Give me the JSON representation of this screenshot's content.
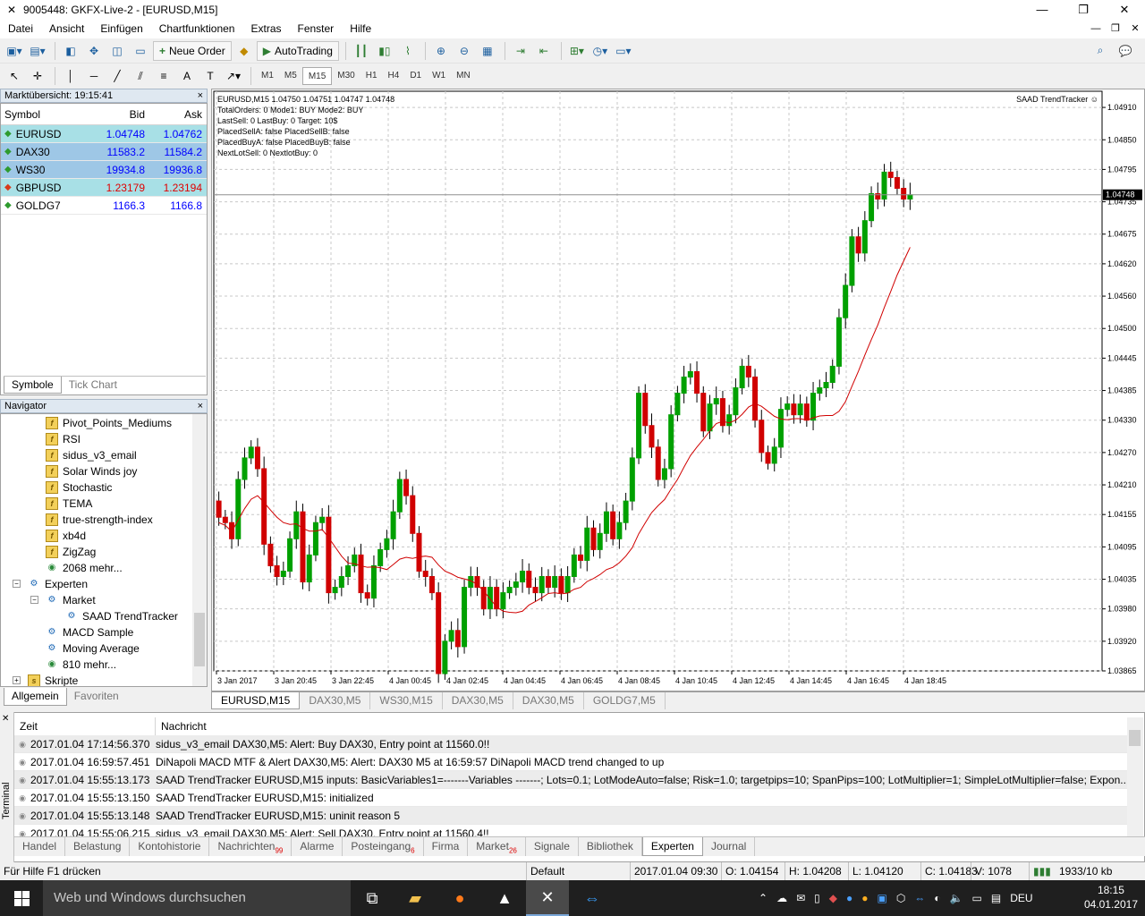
{
  "window": {
    "title": "9005448: GKFX-Live-2 - [EURUSD,M15]",
    "minimize": "—",
    "maximize": "❐",
    "close": "✕"
  },
  "menu": {
    "items": [
      "Datei",
      "Ansicht",
      "Einfügen",
      "Chartfunktionen",
      "Extras",
      "Fenster",
      "Hilfe"
    ],
    "mdi": [
      "—",
      "❐",
      "✕"
    ]
  },
  "toolbar": {
    "new_order": "Neue Order",
    "autotrading": "AutoTrading",
    "timeframes": [
      "M1",
      "M5",
      "M15",
      "M30",
      "H1",
      "H4",
      "D1",
      "W1",
      "MN"
    ],
    "active_timeframe": "M15"
  },
  "market_watch": {
    "header": "Marktübersicht: 19:15:41",
    "columns": [
      "Symbol",
      "Bid",
      "Ask"
    ],
    "rows": [
      {
        "symbol": "EURUSD",
        "bid": "1.04748",
        "ask": "1.04762",
        "dir": "up",
        "bg": "teal",
        "color": "#0000ff"
      },
      {
        "symbol": "DAX30",
        "bid": "11583.2",
        "ask": "11584.2",
        "dir": "up",
        "bg": "blue",
        "color": "#0000ff"
      },
      {
        "symbol": "WS30",
        "bid": "19934.8",
        "ask": "19936.8",
        "dir": "up",
        "bg": "blue",
        "color": "#0000ff"
      },
      {
        "symbol": "GBPUSD",
        "bid": "1.23179",
        "ask": "1.23194",
        "dir": "down",
        "bg": "teal",
        "color": "#e00000"
      },
      {
        "symbol": "GOLDG7",
        "bid": "1166.3",
        "ask": "1166.8",
        "dir": "up",
        "bg": "none",
        "color": "#0000ff"
      }
    ],
    "tabs": [
      "Symbole",
      "Tick Chart"
    ]
  },
  "navigator": {
    "header": "Navigator",
    "items": [
      {
        "label": "Pivot_Points_Mediums",
        "type": "indicator"
      },
      {
        "label": "RSI",
        "type": "indicator"
      },
      {
        "label": "sidus_v3_email",
        "type": "indicator"
      },
      {
        "label": "Solar Winds joy",
        "type": "indicator"
      },
      {
        "label": "Stochastic",
        "type": "indicator"
      },
      {
        "label": "TEMA",
        "type": "indicator"
      },
      {
        "label": "true-strength-index",
        "type": "indicator"
      },
      {
        "label": "xb4d",
        "type": "indicator"
      },
      {
        "label": "ZigZag",
        "type": "indicator"
      },
      {
        "label": "2068 mehr...",
        "type": "globe"
      },
      {
        "label": "Experten",
        "type": "expert-folder"
      },
      {
        "label": "Market",
        "type": "expert-folder"
      },
      {
        "label": "SAAD TrendTracker",
        "type": "expert"
      },
      {
        "label": "MACD Sample",
        "type": "expert"
      },
      {
        "label": "Moving Average",
        "type": "expert"
      },
      {
        "label": "810 mehr...",
        "type": "globe"
      },
      {
        "label": "Skripte",
        "type": "script-folder"
      }
    ],
    "tabs": [
      "Allgemein",
      "Favoriten"
    ]
  },
  "chart": {
    "header": "EURUSD,M15  1.04750 1.04751 1.04747 1.04748",
    "info_lines": [
      "TotalOrders:  0   Mode1:  BUY  Mode2:  BUY",
      "LastSell: 0  LastBuy: 0   Target: 10$",
      "PlacedSellA: false PlacedSellB: false",
      "PlacedBuyA: false PlacedBuyB: false",
      "NextLotSell:  0   NextlotBuy:  0"
    ],
    "ea_label": "SAAD TrendTracker ☺",
    "current_price_label": "1.04748",
    "tabs": [
      "EURUSD,M15",
      "DAX30,M5",
      "WS30,M15",
      "DAX30,M5",
      "DAX30,M5",
      "GOLDG7,M5"
    ]
  },
  "chart_data": {
    "type": "candlestick",
    "symbol": "EURUSD",
    "timeframe": "M15",
    "ylim": [
      1.03865,
      1.0494
    ],
    "y_ticks": [
      "1.04910",
      "1.04850",
      "1.04795",
      "1.04735",
      "1.04675",
      "1.04620",
      "1.04560",
      "1.04500",
      "1.04445",
      "1.04385",
      "1.04330",
      "1.04270",
      "1.04210",
      "1.04155",
      "1.04095",
      "1.04035",
      "1.03980",
      "1.03920",
      "1.03865"
    ],
    "x_ticks": [
      "3 Jan 2017",
      "3 Jan 20:45",
      "3 Jan 22:45",
      "4 Jan 00:45",
      "4 Jan 02:45",
      "4 Jan 04:45",
      "4 Jan 06:45",
      "4 Jan 08:45",
      "4 Jan 10:45",
      "4 Jan 12:45",
      "4 Jan 14:45",
      "4 Jan 16:45",
      "4 Jan 18:45"
    ],
    "up_color": "#00a000",
    "down_color": "#d00000",
    "ma_color": "#d00000",
    "closes": [
      1.0415,
      1.0414,
      1.0411,
      1.0422,
      1.0426,
      1.0428,
      1.0424,
      1.041,
      1.0406,
      1.0404,
      1.0405,
      1.0411,
      1.0416,
      1.0403,
      1.0408,
      1.0414,
      1.0415,
      1.0401,
      1.0402,
      1.0404,
      1.0406,
      1.0408,
      1.0401,
      1.04,
      1.0406,
      1.0409,
      1.0411,
      1.0416,
      1.0422,
      1.0419,
      1.0412,
      1.0405,
      1.0404,
      1.0401,
      1.0386,
      1.0392,
      1.0394,
      1.0391,
      1.0402,
      1.0404,
      1.0402,
      1.0398,
      1.0402,
      1.0398,
      1.0401,
      1.0402,
      1.0403,
      1.0405,
      1.0402,
      1.0401,
      1.0404,
      1.0402,
      1.0404,
      1.0401,
      1.0404,
      1.0408,
      1.0407,
      1.0413,
      1.0409,
      1.0412,
      1.0416,
      1.0411,
      1.0414,
      1.0418,
      1.0426,
      1.0438,
      1.0432,
      1.0428,
      1.0422,
      1.0424,
      1.0434,
      1.0438,
      1.0441,
      1.0442,
      1.0438,
      1.0431,
      1.0436,
      1.0437,
      1.0432,
      1.0434,
      1.0439,
      1.0443,
      1.0441,
      1.0433,
      1.0427,
      1.0425,
      1.0428,
      1.0435,
      1.0436,
      1.0434,
      1.0436,
      1.0433,
      1.0438,
      1.0439,
      1.044,
      1.0443,
      1.0452,
      1.0458,
      1.0467,
      1.0464,
      1.047,
      1.0475,
      1.0474,
      1.0479,
      1.0478,
      1.0476,
      1.0474,
      1.04748
    ]
  },
  "terminal": {
    "side_label": "Terminal",
    "columns": [
      "Zeit",
      "Nachricht"
    ],
    "rows": [
      {
        "time": "2017.01.04 17:14:56.370",
        "msg": "sidus_v3_email DAX30,M5: Alert: Buy DAX30, Entry point at 11560.0!!"
      },
      {
        "time": "2017.01.04 16:59:57.451",
        "msg": "DiNapoli MACD MTF & Alert DAX30,M5: Alert: DAX30 M5 at 16:59:57 DiNapoli MACD trend changed to up"
      },
      {
        "time": "2017.01.04 15:55:13.173",
        "msg": "SAAD TrendTracker EURUSD,M15 inputs: BasicVariables1=-------Variables -------; Lots=0.1; LotModeAuto=false; Risk=1.0; targetpips=10; SpanPips=100; LotMultiplier=1; SimpleLotMultiplier=false; Expon..."
      },
      {
        "time": "2017.01.04 15:55:13.150",
        "msg": "SAAD TrendTracker EURUSD,M15: initialized"
      },
      {
        "time": "2017.01.04 15:55:13.148",
        "msg": "SAAD TrendTracker EURUSD,M15: uninit reason 5"
      },
      {
        "time": "2017.01.04 15:55:06.215",
        "msg": "sidus_v3_email DAX30,M5: Alert: Sell DAX30, Entry point at 11560.4!!"
      }
    ],
    "tabs": [
      {
        "label": "Handel",
        "badge": ""
      },
      {
        "label": "Belastung",
        "badge": ""
      },
      {
        "label": "Kontohistorie",
        "badge": ""
      },
      {
        "label": "Nachrichten",
        "badge": "99"
      },
      {
        "label": "Alarme",
        "badge": ""
      },
      {
        "label": "Posteingang",
        "badge": "6"
      },
      {
        "label": "Firma",
        "badge": ""
      },
      {
        "label": "Market",
        "badge": "26"
      },
      {
        "label": "Signale",
        "badge": ""
      },
      {
        "label": "Bibliothek",
        "badge": ""
      },
      {
        "label": "Experten",
        "badge": ""
      },
      {
        "label": "Journal",
        "badge": ""
      }
    ],
    "active_tab": "Experten"
  },
  "status": {
    "help": "Für Hilfe F1 drücken",
    "profile": "Default",
    "datetime": "2017.01.04 09:30",
    "open": "O: 1.04154",
    "high": "H: 1.04208",
    "low": "L: 1.04120",
    "close": "C: 1.04183",
    "volume": "V: 1078",
    "traffic": "1933/10 kb"
  },
  "taskbar": {
    "search": "Web und Windows durchsuchen",
    "lang": "DEU",
    "time": "18:15",
    "date": "04.01.2017"
  }
}
